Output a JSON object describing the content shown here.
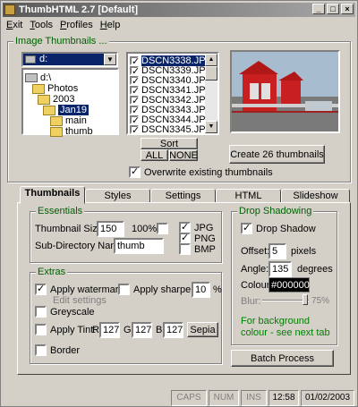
{
  "app": {
    "title": "ThumbHTML 2.7  [Default]"
  },
  "menu": [
    {
      "label": "Exit",
      "u": "E",
      "rest": "xit"
    },
    {
      "label": "Tools",
      "u": "T",
      "rest": "ools"
    },
    {
      "label": "Profiles",
      "u": "P",
      "rest": "rofiles"
    },
    {
      "label": "Help",
      "u": "H",
      "rest": "elp"
    }
  ],
  "image_group": {
    "title": "Image Thumbnails ..."
  },
  "drive": {
    "value": "d:"
  },
  "tree": [
    {
      "label": "d:\\",
      "icon": "drive"
    },
    {
      "label": "Photos",
      "icon": "folder"
    },
    {
      "label": "2003",
      "icon": "folder"
    },
    {
      "label": "Jan19",
      "icon": "folder",
      "selected": true
    },
    {
      "label": "main",
      "icon": "folder"
    },
    {
      "label": "thumb",
      "icon": "folder"
    }
  ],
  "files": [
    "DSCN3338.JPG",
    "DSCN3339.JPG",
    "DSCN3340.JPG",
    "DSCN3341.JPG",
    "DSCN3342.JPG",
    "DSCN3343.JPG",
    "DSCN3344.JPG",
    "DSCN3345.JPG"
  ],
  "sort": {
    "label": "Sort",
    "all": "ALL",
    "none": "NONE"
  },
  "create_button": "Create 26 thumbnails",
  "overwrite": {
    "label": "Overwrite existing thumbnails",
    "checked": true
  },
  "tabs": [
    "Thumbnails",
    "Styles",
    "Settings",
    "HTML",
    "Slideshow"
  ],
  "essentials": {
    "title": "Essentials",
    "size_label": "Thumbnail Size:",
    "size_value": "150",
    "pct_label": "100%",
    "subdir_label": "Sub-Directory Name:",
    "subdir_value": "thumb",
    "jpg": "JPG",
    "png": "PNG",
    "bmp": "BMP"
  },
  "extras": {
    "title": "Extras",
    "watermark": "Apply watermark",
    "edit_settings": "Edit settings",
    "sharpening": "Apply sharpening",
    "sharpen_value": "10",
    "pct": "%",
    "greyscale": "Greyscale",
    "tint": "Apply Tint:",
    "r_label": "R",
    "r": "127",
    "g_label": "G",
    "g": "127",
    "b_label": "B",
    "b": "127",
    "sepia": "Sepia",
    "border": "Border"
  },
  "shadow": {
    "title": "Drop Shadowing",
    "drop": "Drop Shadow",
    "offset_label": "Offset:",
    "offset": "5",
    "offset_unit": "pixels",
    "angle_label": "Angle:",
    "angle": "135",
    "angle_unit": "degrees",
    "colour_label": "Colour:",
    "colour": "#000000",
    "blur_label": "Blur:",
    "blur_value": "75%",
    "note": "For background colour - see next tab"
  },
  "batch_button": "Batch Process",
  "status": {
    "caps": "CAPS",
    "num": "NUM",
    "ins": "INS",
    "time": "12:58",
    "date": "01/02/2003"
  }
}
